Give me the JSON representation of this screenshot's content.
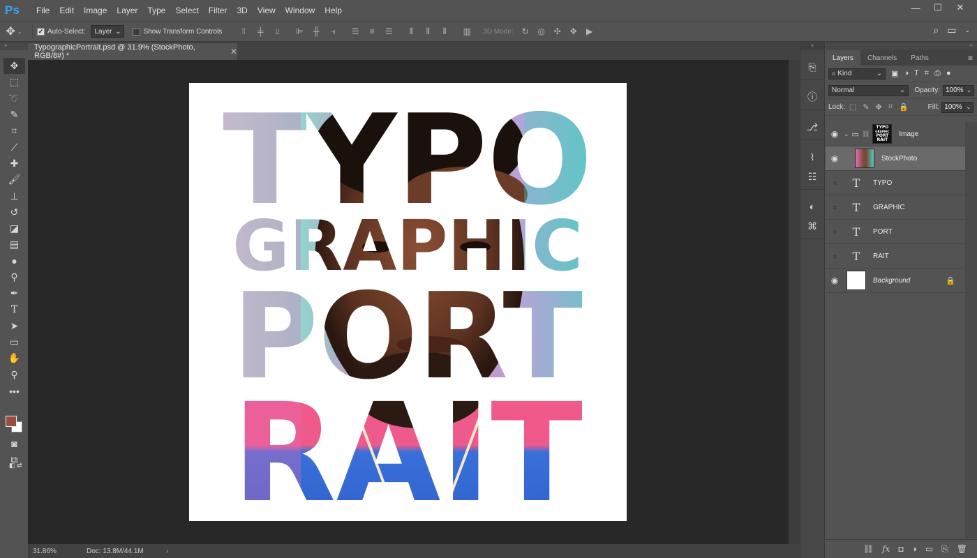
{
  "app": {
    "logo": "Ps"
  },
  "menu": [
    "File",
    "Edit",
    "Image",
    "Layer",
    "Type",
    "Select",
    "Filter",
    "3D",
    "View",
    "Window",
    "Help"
  ],
  "window_controls": [
    "—",
    "☐",
    "✕"
  ],
  "options": {
    "auto_select_label": "Auto-Select:",
    "auto_select_checked": true,
    "auto_select_target": "Layer",
    "show_transform_label": "Show Transform Controls",
    "show_transform_checked": false,
    "mode_3d_label": "3D Mode:"
  },
  "document": {
    "tab_title": "TypographicPortrait.psd @ 31.9% (StockPhoto, RGB/8#) *",
    "zoom": "31.86%",
    "doc_size": "Doc: 13.8M/44.1M"
  },
  "canvas_words": [
    "TYPO",
    "GRAPHIC",
    "PORT",
    "RAIT"
  ],
  "colors": {
    "foreground": "#9b4b40",
    "background": "#ffffff",
    "accent": "#31a8ff"
  },
  "layers_panel": {
    "tabs": [
      "Layers",
      "Channels",
      "Paths"
    ],
    "active_tab": "Layers",
    "filter_kind": "Kind",
    "blend_mode": "Normal",
    "opacity_label": "Opacity:",
    "opacity": "100%",
    "lock_label": "Lock:",
    "fill_label": "Fill:",
    "fill": "100%",
    "layers": [
      {
        "name": "Image",
        "type": "group",
        "visible": true
      },
      {
        "name": "StockPhoto",
        "type": "pixel",
        "visible": true,
        "selected": true
      },
      {
        "name": "TYPO",
        "type": "text",
        "visible": false
      },
      {
        "name": "GRAPHIC",
        "type": "text",
        "visible": false
      },
      {
        "name": "PORT",
        "type": "text",
        "visible": false
      },
      {
        "name": "RAIT",
        "type": "text",
        "visible": false
      },
      {
        "name": "Background",
        "type": "background",
        "visible": true,
        "locked": true
      }
    ]
  }
}
